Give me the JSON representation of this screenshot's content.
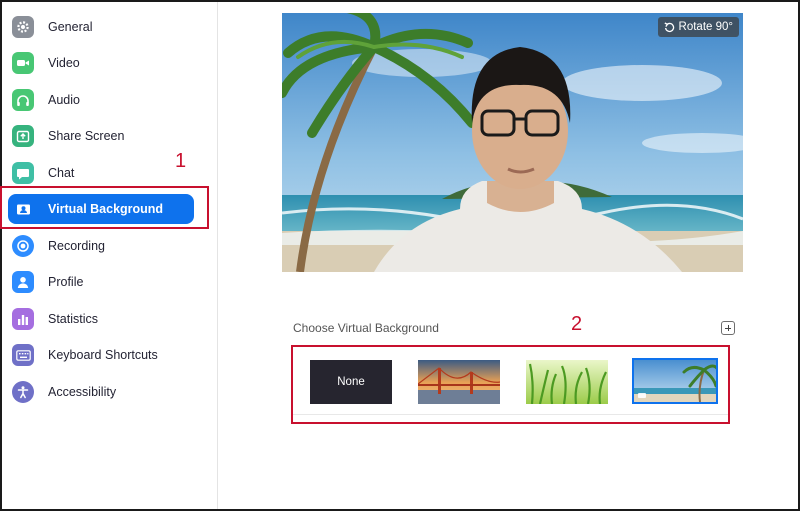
{
  "sidebar": {
    "items": [
      {
        "label": "General",
        "icon": "gear-icon",
        "color": "#8a8f98"
      },
      {
        "label": "Video",
        "icon": "video-camera-icon",
        "color": "#48c774"
      },
      {
        "label": "Audio",
        "icon": "headphones-icon",
        "color": "#48c774"
      },
      {
        "label": "Share Screen",
        "icon": "share-screen-icon",
        "color": "#36b37e"
      },
      {
        "label": "Chat",
        "icon": "chat-bubble-icon",
        "color": "#3fbfa5"
      },
      {
        "label": "Virtual Background",
        "icon": "person-card-icon",
        "color": "#0e72ed",
        "active": true
      },
      {
        "label": "Recording",
        "icon": "record-icon",
        "color": "#2d8cff"
      },
      {
        "label": "Profile",
        "icon": "user-icon",
        "color": "#2d8cff"
      },
      {
        "label": "Statistics",
        "icon": "bar-chart-icon",
        "color": "#a56ee0"
      },
      {
        "label": "Keyboard Shortcuts",
        "icon": "keyboard-icon",
        "color": "#6f70c7"
      },
      {
        "label": "Accessibility",
        "icon": "accessibility-icon",
        "color": "#6f70c7"
      }
    ]
  },
  "preview": {
    "rotate_label": "Rotate 90°",
    "rotate_icon": "rotate-icon"
  },
  "backgrounds": {
    "section_label": "Choose Virtual Background",
    "add_icon": "plus-square-icon",
    "none_label": "None",
    "thumbnails": [
      "None",
      "golden-gate-bridge",
      "green-grass",
      "beach-palm"
    ],
    "selected": "beach-palm"
  },
  "annotations": {
    "marker_1": "1",
    "marker_2": "2",
    "color": "#c8102e"
  },
  "colors": {
    "accent": "#0e72ed",
    "annotation": "#c8102e"
  }
}
